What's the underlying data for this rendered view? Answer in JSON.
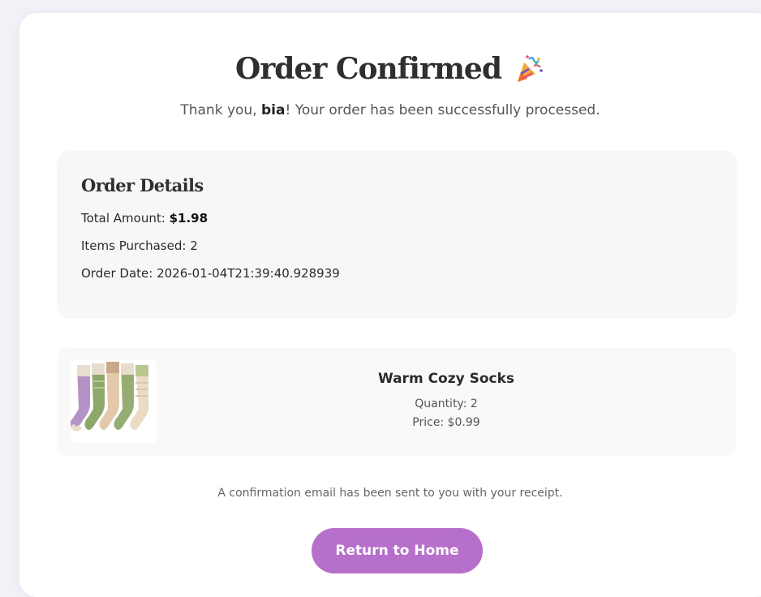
{
  "header": {
    "title": "Order Confirmed",
    "icon": "party-popper-icon",
    "thanks_prefix": "Thank you, ",
    "customer_name": "bia",
    "thanks_suffix": "! Your order has been successfully processed."
  },
  "order_details": {
    "heading": "Order Details",
    "total_label": "Total Amount: ",
    "total_value": "$1.98",
    "items_label": "Items Purchased: ",
    "items_value": "2",
    "date_label": "Order Date: ",
    "date_value": "2026-01-04T21:39:40.928939"
  },
  "items": [
    {
      "name": "Warm Cozy Socks",
      "quantity_line": "Quantity: 2",
      "price_line": "Price: $0.99",
      "image_icon": "socks-product-image"
    }
  ],
  "footer": {
    "confirmation_note": "A confirmation email has been sent to you with your receipt.",
    "home_button_label": "Return to Home"
  },
  "colors": {
    "accent": "#b76fcc",
    "panel": "#f7f6f9",
    "page_background": "#f3f1f7"
  }
}
